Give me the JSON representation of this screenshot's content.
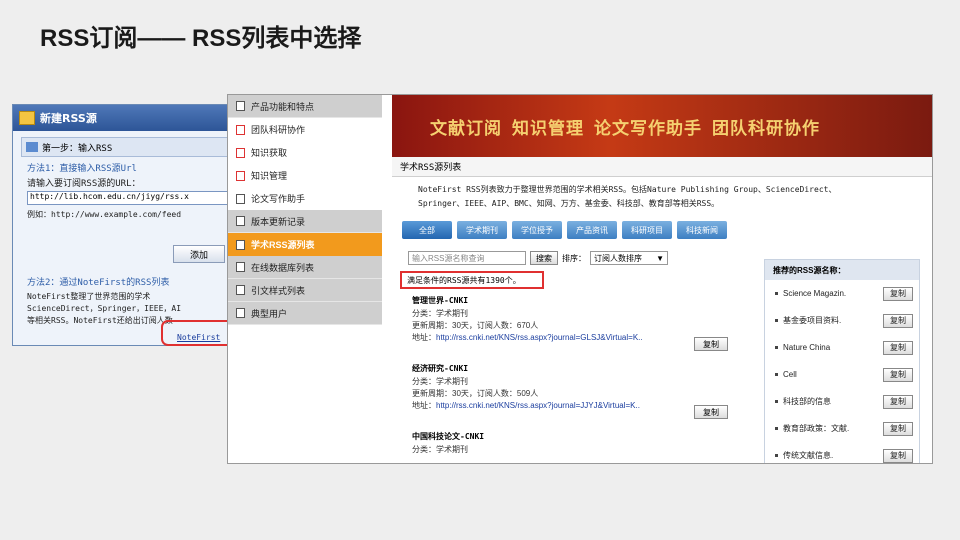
{
  "slide": {
    "title": "RSS订阅—— RSS列表中选择"
  },
  "dialog": {
    "title": "新建RSS源",
    "step": "第一步：输入RSS",
    "method1": "方法1：直接输入RSS源Url",
    "label": "请输入要订阅RSS源的URL：",
    "url_value": "http://lib.hcom.edu.cn/jiyg/rss.x",
    "example": "例如：http://www.example.com/feed",
    "add_button": "添加",
    "method2": "方法2：通过NoteFirst的RSS列表",
    "method2_text1": "NoteFirst整理了世界范围的学术",
    "method2_text2": "ScienceDirect，Springer，IEEE，AI",
    "method2_text3": "等相关RSS。NoteFirst还给出订阅人数",
    "link": "NoteFirst"
  },
  "menu": {
    "items": [
      {
        "label": "产品功能和特点",
        "style": "gray"
      },
      {
        "label": "团队科研协作",
        "style": "white"
      },
      {
        "label": "知识获取",
        "style": "white"
      },
      {
        "label": "知识管理",
        "style": "white"
      },
      {
        "label": "论文写作助手",
        "style": "white"
      },
      {
        "label": "版本更新记录",
        "style": "gray"
      },
      {
        "label": "学术RSS源列表",
        "style": "orange"
      },
      {
        "label": "在线数据库列表",
        "style": "gray"
      },
      {
        "label": "引文样式列表",
        "style": "gray"
      },
      {
        "label": "典型用户",
        "style": "gray"
      }
    ]
  },
  "banner": {
    "items": [
      "文献订阅",
      "知识管理",
      "论文写作助手",
      "团队科研协作"
    ]
  },
  "main": {
    "section_title": "学术RSS源列表",
    "intro_line1": "NoteFirst RSS列表致力于整理世界范围的学术相关RSS。包括Nature Publishing Group、ScienceDirect、",
    "intro_line2": "Springer、IEEE、AIP、BMC、知网、万方、基金委、科技部、教育部等相关RSS。",
    "tabs": [
      "全部",
      "学术期刊",
      "学位授予",
      "产品资讯",
      "科研项目",
      "科技新闻"
    ],
    "search_placeholder": "输入RSS源名称查询",
    "search_button": "搜索",
    "sort_label": "排序：",
    "sort_value": "订阅人数排序",
    "total": "满足条件的RSS源共有1390个。",
    "list": [
      {
        "name": "管理世界-CNKI",
        "category": "分类：学术期刊",
        "meta": "更新周期：30天，订阅人数：670人",
        "addr_label": "地址：",
        "addr": "http://rss.cnki.net/KNS/rss.aspx?journal=GLSJ&Virtual=K..",
        "copy": "复制"
      },
      {
        "name": "经济研究-CNKI",
        "category": "分类：学术期刊",
        "meta": "更新周期：30天，订阅人数：509人",
        "addr_label": "地址：",
        "addr": "http://rss.cnki.net/KNS/rss.aspx?journal=JJYJ&Virtual=K..",
        "copy": "复制"
      },
      {
        "name": "中国科技论文-CNKI",
        "category": "分类：学术期刊",
        "meta": "",
        "addr_label": "",
        "addr": "",
        "copy": ""
      }
    ],
    "recommend": {
      "title": "推荐的RSS源名称：",
      "items": [
        {
          "name": "Science Magazin.",
          "copy": "复制"
        },
        {
          "name": "基金委项目资料.",
          "copy": "复制"
        },
        {
          "name": "Nature China",
          "copy": "复制"
        },
        {
          "name": "Cell",
          "copy": "复制"
        },
        {
          "name": "科技部的信息",
          "copy": "复制"
        },
        {
          "name": "教育部政策：文献.",
          "copy": "复制"
        },
        {
          "name": "传统文献信息.",
          "copy": "复制"
        }
      ]
    }
  }
}
